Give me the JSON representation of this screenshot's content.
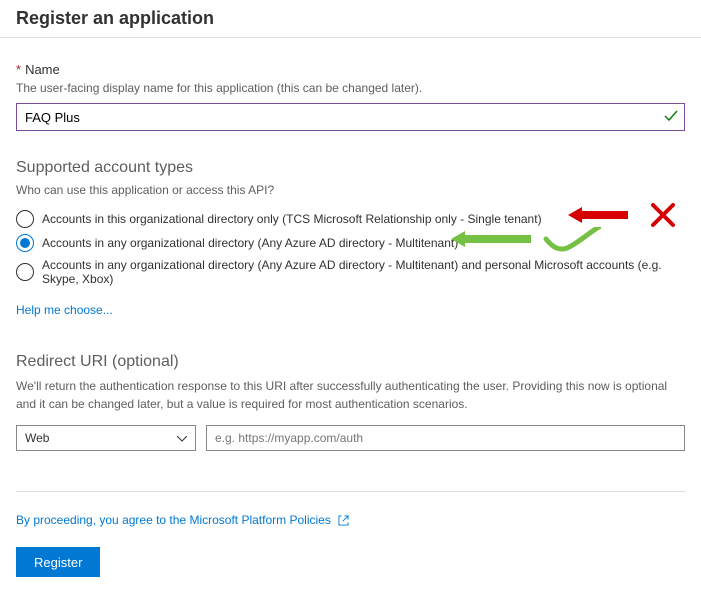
{
  "title": "Register an application",
  "nameField": {
    "label": "Name",
    "hint": "The user-facing display name for this application (this can be changed later).",
    "value": "FAQ Plus"
  },
  "accountTypes": {
    "header": "Supported account types",
    "hint": "Who can use this application or access this API?",
    "options": [
      {
        "label": "Accounts in this organizational directory only (TCS Microsoft Relationship only - Single tenant)",
        "selected": false
      },
      {
        "label": "Accounts in any organizational directory (Any Azure AD directory - Multitenant)",
        "selected": true
      },
      {
        "label": "Accounts in any organizational directory (Any Azure AD directory - Multitenant) and personal Microsoft accounts (e.g. Skype, Xbox)",
        "selected": false
      }
    ],
    "helpLink": "Help me choose..."
  },
  "redirect": {
    "header": "Redirect URI (optional)",
    "desc": "We'll return the authentication response to this URI after successfully authenticating the user. Providing this now is optional and it can be changed later, but a value is required for most authentication scenarios.",
    "typeSelected": "Web",
    "placeholder": "e.g. https://myapp.com/auth"
  },
  "footer": {
    "agree": "By proceeding, you agree to the Microsoft Platform Policies",
    "button": "Register"
  }
}
